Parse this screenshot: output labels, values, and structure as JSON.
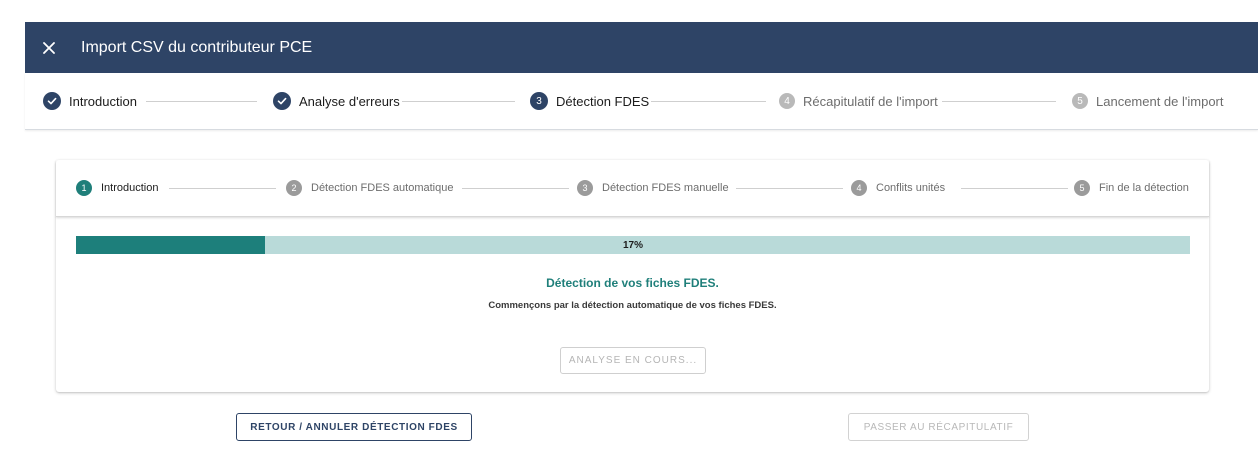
{
  "dialog": {
    "title": "Import CSV du contributeur PCE",
    "header_color": "#2e4466"
  },
  "main_steps": [
    {
      "num": "1",
      "label": "Introduction",
      "state": "done"
    },
    {
      "num": "2",
      "label": "Analyse d'erreurs",
      "state": "done"
    },
    {
      "num": "3",
      "label": "Détection FDES",
      "state": "active"
    },
    {
      "num": "4",
      "label": "Récapitulatif de l'import",
      "state": "pending"
    },
    {
      "num": "5",
      "label": "Lancement de l'import",
      "state": "pending"
    }
  ],
  "sub_steps": [
    {
      "num": "1",
      "label": "Introduction",
      "state": "active"
    },
    {
      "num": "2",
      "label": "Détection FDES automatique",
      "state": "pending"
    },
    {
      "num": "3",
      "label": "Détection FDES manuelle",
      "state": "pending"
    },
    {
      "num": "4",
      "label": "Conflits unités",
      "state": "pending"
    },
    {
      "num": "5",
      "label": "Fin de la détection",
      "state": "pending"
    }
  ],
  "progress": {
    "percent": 17,
    "label": "17%",
    "fill_color": "#1d7f7b",
    "track_color": "#b9dad9"
  },
  "content": {
    "heading": "Détection de vos fiches FDES.",
    "subtext": "Commençons par la détection automatique de vos fiches FDES.",
    "analyse_label": "ANALYSE EN COURS..."
  },
  "footer": {
    "retour_label": "RETOUR / ANNULER DÉTECTION FDES",
    "passer_label": "PASSER AU RÉCAPITULATIF"
  },
  "accent_color": "#1f7f7a"
}
